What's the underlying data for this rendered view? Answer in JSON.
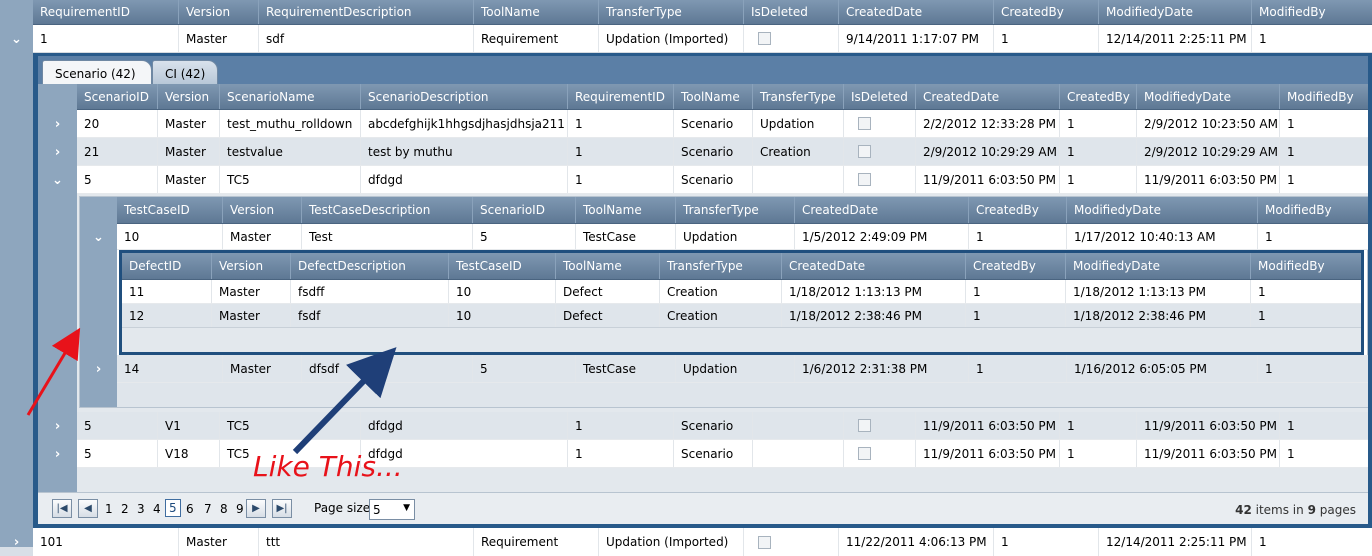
{
  "main_grid": {
    "columns": [
      "RequirementID",
      "Version",
      "RequirementDescription",
      "ToolName",
      "TransferType",
      "IsDeleted",
      "CreatedDate",
      "CreatedBy",
      "ModifiedyDate",
      "ModifiedBy"
    ],
    "row1": [
      "1",
      "Master",
      "sdf",
      "Requirement",
      "Updation (Imported)",
      "",
      "9/14/2011 1:17:07 PM",
      "1",
      "12/14/2011 2:25:11 PM",
      "1"
    ],
    "row2": [
      "101",
      "Master",
      "ttt",
      "Requirement",
      "Updation (Imported)",
      "",
      "11/22/2011 4:06:13 PM",
      "1",
      "12/14/2011 2:25:11 PM",
      "1"
    ]
  },
  "tabs": {
    "scenario": "Scenario (42)",
    "ci": "CI (42)"
  },
  "scenario_grid": {
    "columns": [
      "ScenarioID",
      "Version",
      "ScenarioName",
      "ScenarioDescription",
      "RequirementID",
      "ToolName",
      "TransferType",
      "IsDeleted",
      "CreatedDate",
      "CreatedBy",
      "ModifiedyDate",
      "ModifiedBy"
    ],
    "rows": [
      [
        "20",
        "Master",
        "test_muthu_rolldown",
        "abcdefghijk1hhgsdjhasjdhsja211",
        "1",
        "Scenario",
        "Updation",
        "",
        "2/2/2012 12:33:28 PM",
        "1",
        "2/9/2012 10:23:50 AM",
        "1"
      ],
      [
        "21",
        "Master",
        "testvalue",
        "test by muthu",
        "1",
        "Scenario",
        "Creation",
        "",
        "2/9/2012 10:29:29 AM",
        "1",
        "2/9/2012 10:29:29 AM",
        "1"
      ],
      [
        "5",
        "Master",
        "TC5",
        "dfdgd",
        "1",
        "Scenario",
        "",
        "",
        "11/9/2011 6:03:50 PM",
        "1",
        "11/9/2011 6:03:50 PM",
        "1"
      ],
      [
        "5",
        "V1",
        "TC5",
        "dfdgd",
        "1",
        "Scenario",
        "",
        "",
        "11/9/2011 6:03:50 PM",
        "1",
        "11/9/2011 6:03:50 PM",
        "1"
      ],
      [
        "5",
        "V18",
        "TC5",
        "dfdgd",
        "1",
        "Scenario",
        "",
        "",
        "11/9/2011 6:03:50 PM",
        "1",
        "11/9/2011 6:03:50 PM",
        "1"
      ]
    ]
  },
  "testcase_grid": {
    "columns": [
      "TestCaseID",
      "Version",
      "TestCaseDescription",
      "ScenarioID",
      "ToolName",
      "TransferType",
      "CreatedDate",
      "CreatedBy",
      "ModifiedyDate",
      "ModifiedBy"
    ],
    "rows": [
      [
        "10",
        "Master",
        "Test",
        "5",
        "TestCase",
        "Updation",
        "1/5/2012 2:49:09 PM",
        "1",
        "1/17/2012 10:40:13 AM",
        "1"
      ],
      [
        "14",
        "Master",
        "dfsdf",
        "5",
        "TestCase",
        "Updation",
        "1/6/2012 2:31:38 PM",
        "1",
        "1/16/2012 6:05:05 PM",
        "1"
      ]
    ]
  },
  "defect_grid": {
    "columns": [
      "DefectID",
      "Version",
      "DefectDescription",
      "TestCaseID",
      "ToolName",
      "TransferType",
      "CreatedDate",
      "CreatedBy",
      "ModifiedyDate",
      "ModifiedBy"
    ],
    "rows": [
      [
        "11",
        "Master",
        "fsdff",
        "10",
        "Defect",
        "Creation",
        "1/18/2012 1:13:13 PM",
        "1",
        "1/18/2012 1:13:13 PM",
        "1"
      ],
      [
        "12",
        "Master",
        "fsdf",
        "10",
        "Defect",
        "Creation",
        "1/18/2012 2:38:46 PM",
        "1",
        "1/18/2012 2:38:46 PM",
        "1"
      ]
    ]
  },
  "pager": {
    "pages": [
      "1",
      "2",
      "3",
      "4",
      "5",
      "6",
      "7",
      "8",
      "9"
    ],
    "current": "5",
    "page_size_label": "Page size:",
    "page_size_value": "5",
    "items_count": "42",
    "items_text": "items in",
    "pages_count": "9",
    "pages_text": "pages"
  },
  "annotation": {
    "text": "Like This..."
  },
  "colors": {
    "header": "#6a84a0",
    "expander_column": "#8ea6be",
    "annotation_red": "#e8121a",
    "annotation_blue": "#1f3f78"
  }
}
